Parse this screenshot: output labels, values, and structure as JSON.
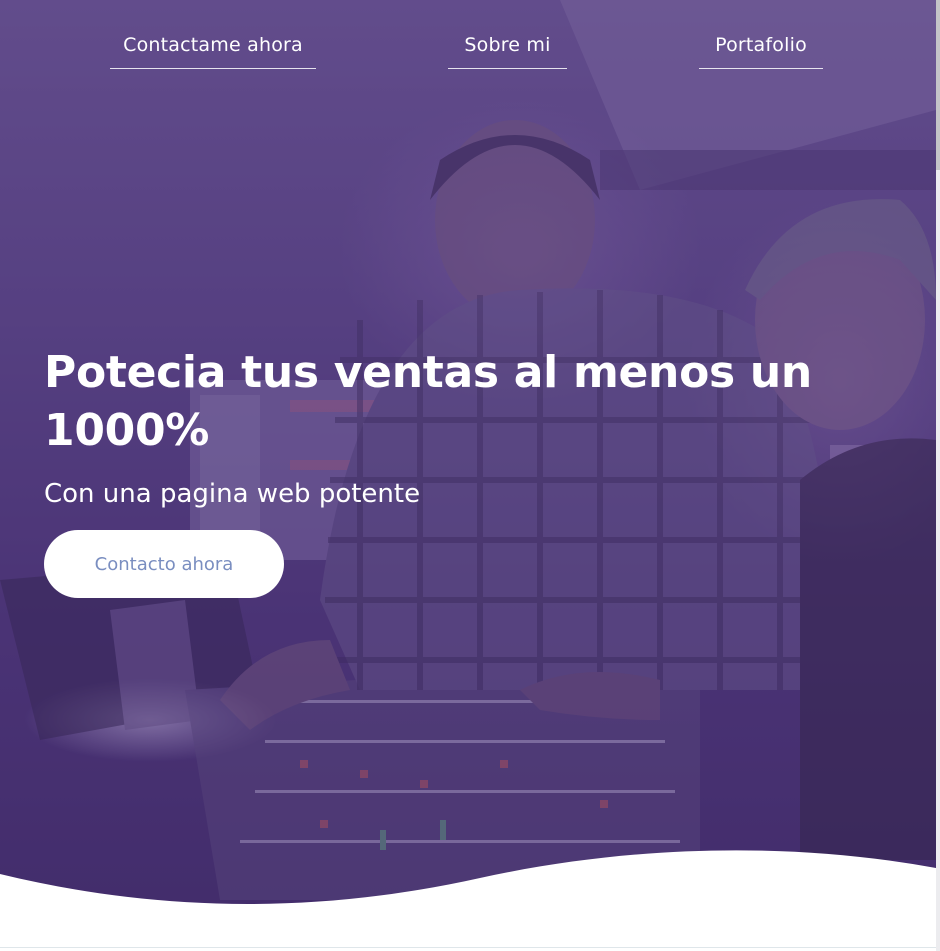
{
  "nav": {
    "items": [
      {
        "label": "Contactame ahora"
      },
      {
        "label": "Sobre mi"
      },
      {
        "label": "Portafolio"
      }
    ]
  },
  "hero": {
    "headline": "Potecia tus ventas al menos un 1000%",
    "subheadline": "Con una pagina web potente",
    "cta_label": "Contacto ahora",
    "overlay_color": "#4b3476",
    "cta_text_color": "#7a8ec0"
  }
}
